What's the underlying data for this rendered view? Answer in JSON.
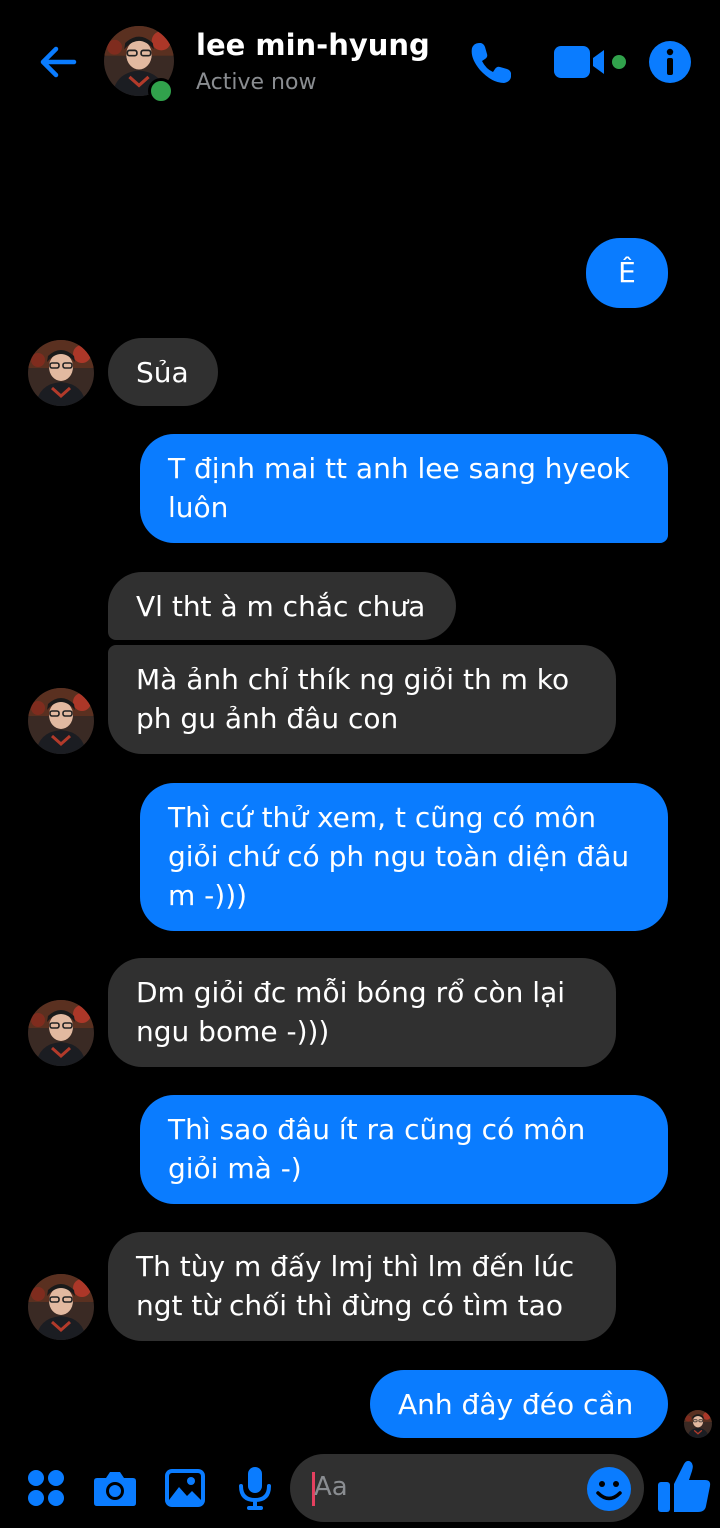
{
  "header": {
    "contact_name": "lee min-hyung",
    "status": "Active now"
  },
  "colors": {
    "accent": "#0a7cff",
    "received_bubble": "#303030",
    "online": "#31a24c",
    "background": "#000000"
  },
  "icons": [
    "back-arrow-icon",
    "phone-icon",
    "video-camera-icon",
    "info-icon",
    "apps-grid-icon",
    "camera-icon",
    "gallery-icon",
    "microphone-icon",
    "emoji-icon",
    "thumbs-up-icon"
  ],
  "messages": [
    {
      "from": "me",
      "text": "Ê"
    },
    {
      "from": "them",
      "text": "Sủa"
    },
    {
      "from": "me",
      "text": "T định mai tt anh lee sang hyeok luôn"
    },
    {
      "from": "them",
      "text": "Vl tht à m chắc chưa"
    },
    {
      "from": "them",
      "text": "Mà ảnh chỉ thík ng giỏi th m ko ph gu ảnh đâu con"
    },
    {
      "from": "me",
      "text": "Thì cứ thử xem, t cũng có môn giỏi chứ có ph ngu toàn diện đâu m -)))"
    },
    {
      "from": "them",
      "text": "Dm giỏi đc mỗi bóng rổ còn lại ngu bome -)))"
    },
    {
      "from": "me",
      "text": "Thì sao đâu ít ra cũng có môn giỏi mà -)"
    },
    {
      "from": "them",
      "text": "Th tùy m đấy lmj thì lm đến lúc ngt từ chối thì đừng có tìm tao"
    },
    {
      "from": "me",
      "text": "Anh đây đéo cần"
    }
  ],
  "composer": {
    "placeholder": "Aa"
  }
}
